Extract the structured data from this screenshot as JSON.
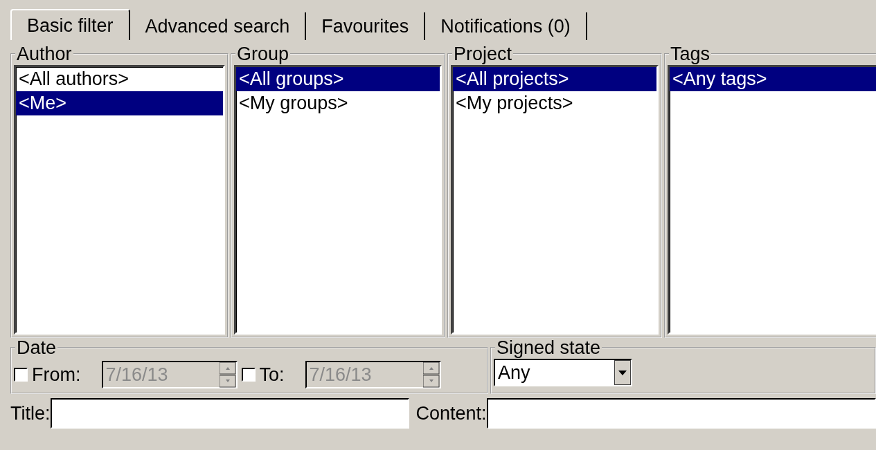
{
  "tabs": [
    {
      "label": "Basic filter",
      "selected": true
    },
    {
      "label": "Advanced search",
      "selected": false
    },
    {
      "label": "Favourites",
      "selected": false
    },
    {
      "label": "Notifications (0)",
      "selected": false
    }
  ],
  "filters": [
    {
      "title": "Author",
      "items": [
        {
          "label": "<All authors>",
          "selected": false
        },
        {
          "label": "<Me>",
          "selected": true
        }
      ]
    },
    {
      "title": "Group",
      "items": [
        {
          "label": "<All groups>",
          "selected": true
        },
        {
          "label": "<My groups>",
          "selected": false
        }
      ]
    },
    {
      "title": "Project",
      "items": [
        {
          "label": "<All projects>",
          "selected": true
        },
        {
          "label": "<My projects>",
          "selected": false
        }
      ]
    },
    {
      "title": "Tags",
      "items": [
        {
          "label": "<Any tags>",
          "selected": true
        }
      ]
    }
  ],
  "date": {
    "title": "Date",
    "ranges": [
      {
        "label": "From:",
        "checked": false,
        "value": "7/16/13",
        "disabled": true
      },
      {
        "label": "To:",
        "checked": false,
        "value": "7/16/13",
        "disabled": true
      }
    ]
  },
  "signed_state": {
    "title": "Signed state",
    "value": "Any"
  },
  "text_fields": [
    {
      "label": "Title:"
    },
    {
      "label": "Content:"
    }
  ]
}
